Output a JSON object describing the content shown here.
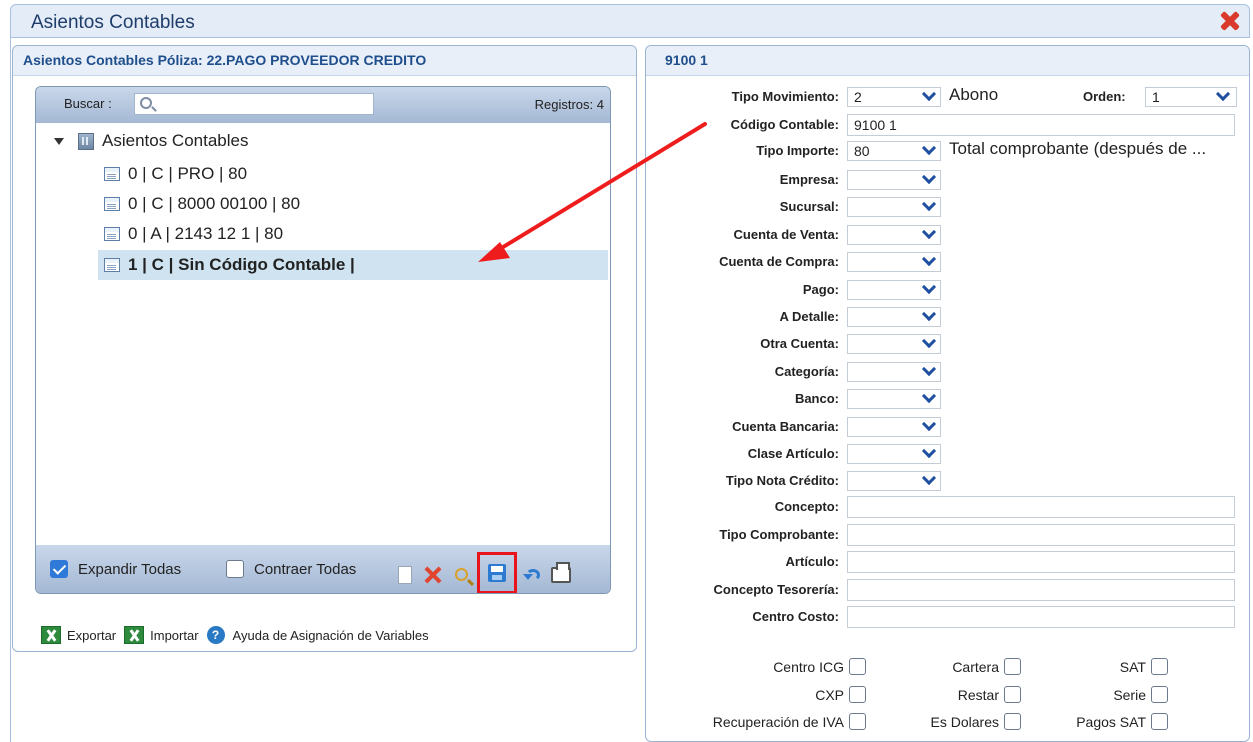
{
  "window": {
    "title": "Asientos Contables"
  },
  "left": {
    "header": "Asientos Contables Póliza: 22.PAGO PROVEEDOR CREDITO",
    "search_label": "Buscar :",
    "search_value": "",
    "registros": "Registros: 4",
    "tree_root": "Asientos Contables",
    "items": [
      {
        "label": "0 | C | PRO | 80"
      },
      {
        "label": "0 | C | 8000 00100 | 80"
      },
      {
        "label": "0 | A | 2143 12 1 | 80"
      },
      {
        "label": "1 | C | Sin Código Contable |"
      }
    ],
    "expand_all": "Expandir Todas",
    "collapse_all": "Contraer Todas",
    "export": "Exportar",
    "import": "Importar",
    "help": "Ayuda de Asignación de Variables"
  },
  "right": {
    "header": "9100 1",
    "tipo_movimiento_label": "Tipo Movimiento:",
    "tipo_movimiento_value": "2",
    "tipo_movimiento_note": "Abono",
    "orden_label": "Orden:",
    "orden_value": "1",
    "codigo_contable_label": "Código Contable:",
    "codigo_contable_value": "9100 1",
    "tipo_importe_label": "Tipo Importe:",
    "tipo_importe_value": "80",
    "tipo_importe_note": "Total comprobante (después de ...",
    "select_fields": [
      {
        "label": "Empresa:"
      },
      {
        "label": "Sucursal:"
      },
      {
        "label": "Cuenta de Venta:"
      },
      {
        "label": "Cuenta de Compra:"
      },
      {
        "label": "Pago:"
      },
      {
        "label": "A Detalle:"
      },
      {
        "label": "Otra Cuenta:"
      },
      {
        "label": "Categoría:"
      },
      {
        "label": "Banco:"
      },
      {
        "label": "Cuenta Bancaria:"
      },
      {
        "label": "Clase Artículo:"
      },
      {
        "label": "Tipo Nota Crédito:"
      }
    ],
    "text_fields": [
      {
        "label": "Concepto:",
        "value": ""
      },
      {
        "label": "Tipo Comprobante:",
        "value": ""
      },
      {
        "label": "Artículo:",
        "value": ""
      },
      {
        "label": "Concepto Tesorería:",
        "value": ""
      },
      {
        "label": "Centro Costo:",
        "value": ""
      }
    ],
    "checkboxes": [
      {
        "label": "Centro ICG"
      },
      {
        "label": "Cartera"
      },
      {
        "label": "SAT"
      },
      {
        "label": "CXP"
      },
      {
        "label": "Restar"
      },
      {
        "label": "Serie"
      },
      {
        "label": "Recuperación de IVA"
      },
      {
        "label": "Es Dolares"
      },
      {
        "label": "Pagos SAT"
      }
    ]
  },
  "colors": {
    "accent_blue": "#1f4e8c",
    "selection": "#cfe3f0",
    "highlight_red": "#e8131b"
  }
}
